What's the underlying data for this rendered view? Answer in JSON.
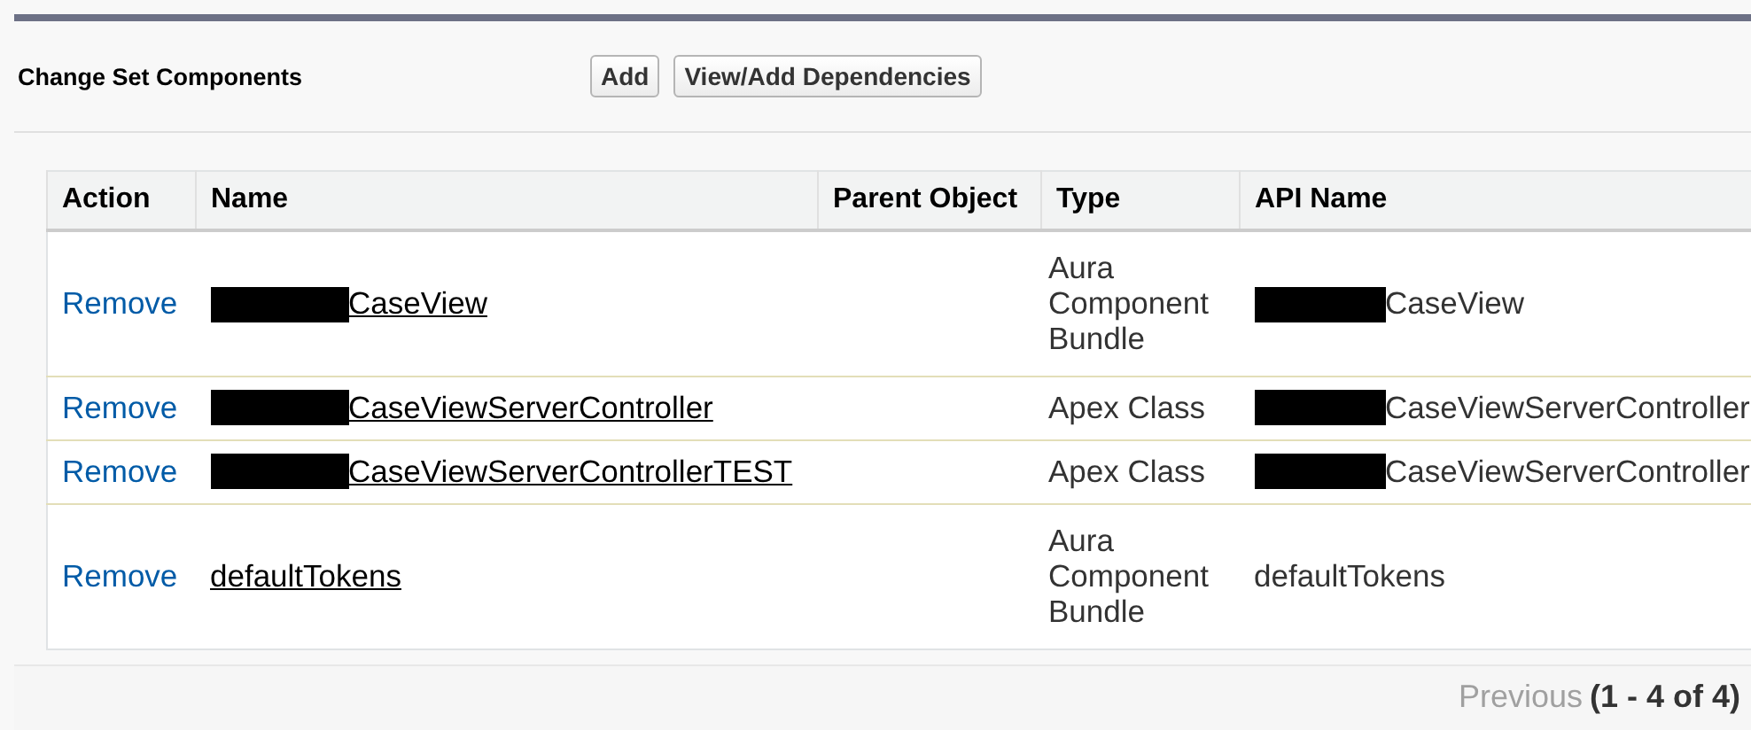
{
  "header": {
    "title": "Change Set Components",
    "buttons": [
      "Add",
      "View/Add Dependencies"
    ]
  },
  "table": {
    "columns": [
      "Action",
      "Name",
      "Parent Object",
      "Type",
      "API Name"
    ],
    "rows": [
      {
        "action": "Remove",
        "name": "CaseView",
        "name_redacted": true,
        "type": "Aura Component Bundle",
        "api_name": "CaseView",
        "api_redacted": true
      },
      {
        "action": "Remove",
        "name": "CaseViewServerController",
        "name_redacted": true,
        "type": "Apex Class",
        "api_name": "CaseViewServerController",
        "api_redacted": true
      },
      {
        "action": "Remove",
        "name": "CaseViewServerControllerTEST",
        "name_redacted": true,
        "type": "Apex Class",
        "api_name": "CaseViewServerController",
        "api_redacted": true
      },
      {
        "action": "Remove",
        "name": "defaultTokens",
        "name_redacted": false,
        "type": "Aura Component Bundle",
        "api_name": "defaultTokens",
        "api_redacted": false
      }
    ]
  },
  "pagination": {
    "previous": "Previous",
    "range": "(1 - 4 of 4)"
  }
}
